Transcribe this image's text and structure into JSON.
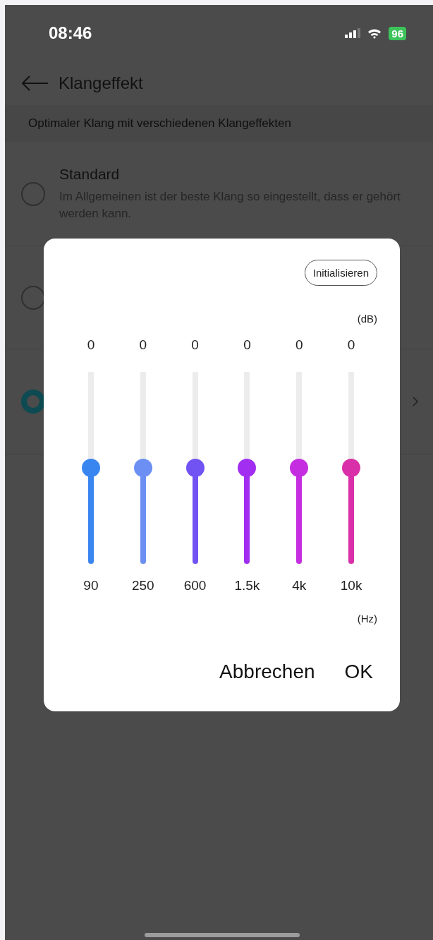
{
  "status_bar": {
    "time": "08:46",
    "battery": "96"
  },
  "header": {
    "title": "Klangeffekt"
  },
  "subtitle": "Optimaler Klang mit verschiedenen Klangeffekten",
  "options": [
    {
      "title": "Standard",
      "description": "Im Allgemeinen ist der beste Klang so eingestellt, dass er gehört werden kann.",
      "selected": false,
      "has_chevron": false
    },
    {
      "selected": false,
      "has_chevron": false
    },
    {
      "selected": true,
      "has_chevron": true
    }
  ],
  "dialog": {
    "reset_button": "Initialisieren",
    "db_unit": "(dB)",
    "hz_unit": "(Hz)",
    "bands": [
      {
        "value": "0",
        "frequency": "90",
        "level": 0.5,
        "color": "#3a86f0"
      },
      {
        "value": "0",
        "frequency": "250",
        "level": 0.5,
        "color": "#6b8ff2"
      },
      {
        "value": "0",
        "frequency": "600",
        "level": 0.5,
        "color": "#7153f3"
      },
      {
        "value": "0",
        "frequency": "1.5k",
        "level": 0.5,
        "color": "#a12ef0"
      },
      {
        "value": "0",
        "frequency": "4k",
        "level": 0.5,
        "color": "#c52ee0"
      },
      {
        "value": "0",
        "frequency": "10k",
        "level": 0.5,
        "color": "#d92fa8"
      }
    ],
    "buttons": [
      "Abbrechen",
      "OK"
    ]
  }
}
